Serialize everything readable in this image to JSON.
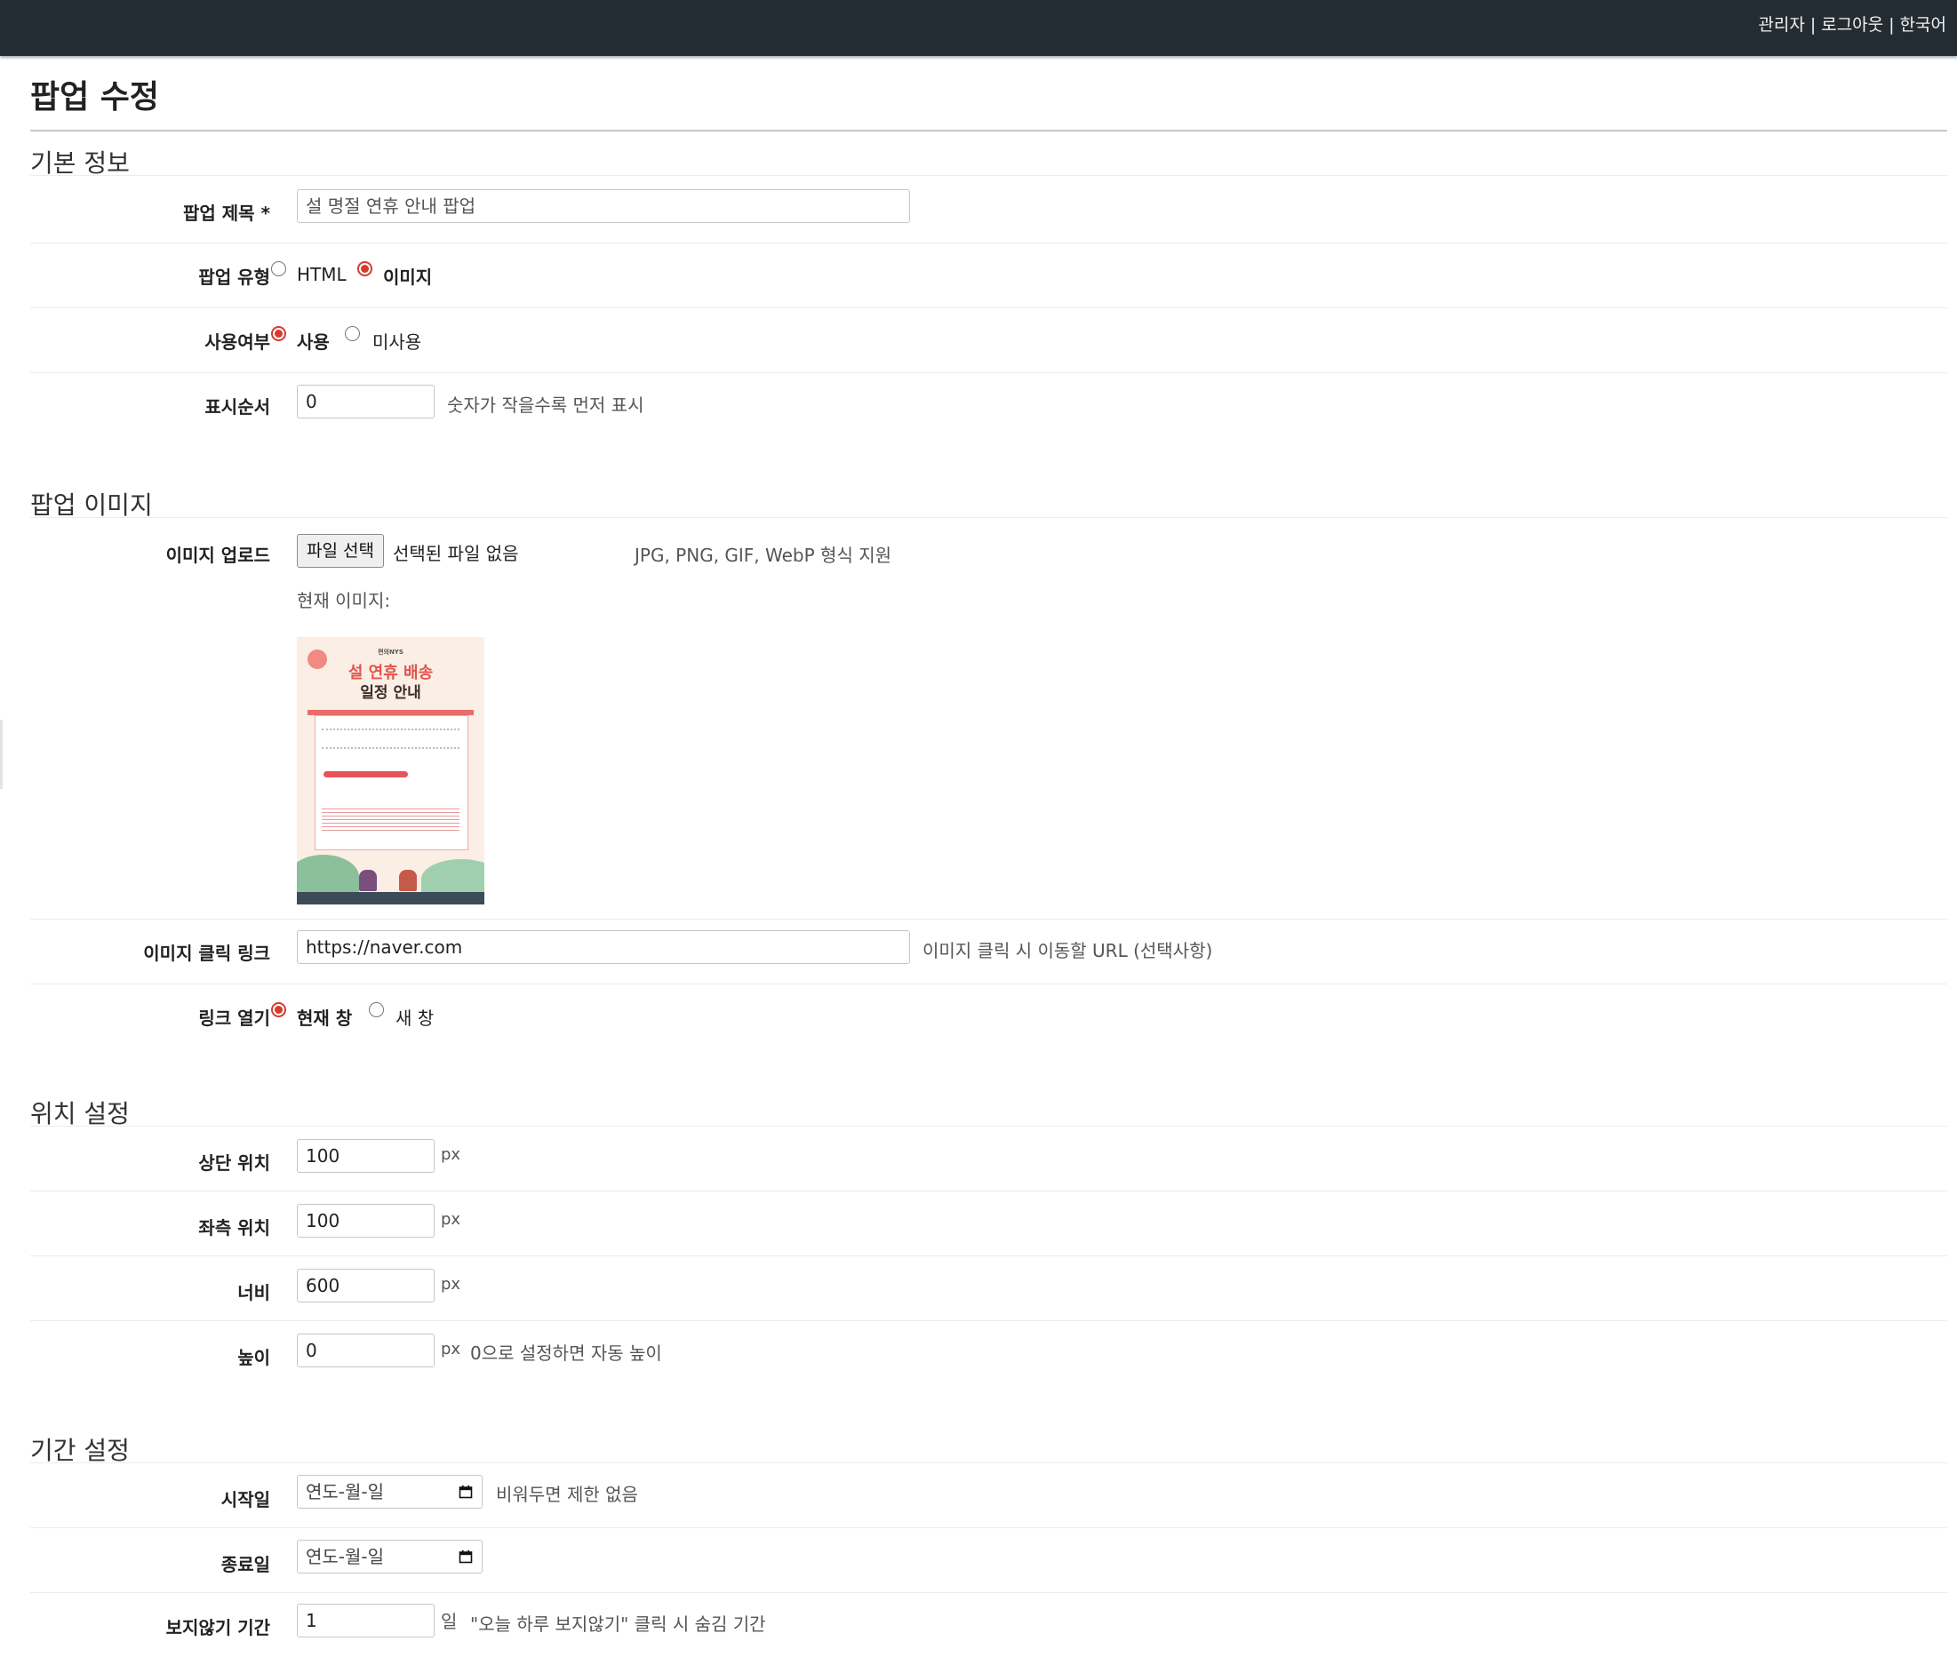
{
  "topnav": {
    "admin": "관리자",
    "logout": "로그아웃",
    "language": "한국어",
    "separator": "|"
  },
  "page_title": "팝업 수정",
  "sections": {
    "basic": "기본 정보",
    "image": "팝업 이미지",
    "position": "위치 설정",
    "period": "기간 설정"
  },
  "basic": {
    "title_label": "팝업 제목 *",
    "title_value": "설 명절 연휴 안내 팝업",
    "type_label": "팝업 유형",
    "type_options": {
      "html": "HTML",
      "image": "이미지"
    },
    "type_selected": "이미지",
    "use_label": "사용여부",
    "use_options": {
      "use": "사용",
      "unused": "미사용"
    },
    "use_selected": "사용",
    "order_label": "표시순서",
    "order_value": "0",
    "order_hint": "숫자가 작을수록 먼저 표시"
  },
  "image": {
    "upload_label": "이미지 업로드",
    "file_button": "파일 선택",
    "file_status": "선택된 파일 없음",
    "format_hint": "JPG, PNG, GIF, WebP 형식 지원",
    "current_label": "현재 이미지:",
    "preview": {
      "brand": "편의NYS",
      "line1": "설 연휴 배송",
      "line2": "일정 안내"
    },
    "link_label": "이미지 클릭 링크",
    "link_value": "https://naver.com",
    "link_hint": "이미지 클릭 시 이동할 URL (선택사항)",
    "open_label": "링크 열기",
    "open_options": {
      "current": "현재 창",
      "new": "새 창"
    },
    "open_selected": "현재 창"
  },
  "position": {
    "top_label": "상단 위치",
    "top_value": "100",
    "left_label": "좌측 위치",
    "left_value": "100",
    "width_label": "너비",
    "width_value": "600",
    "height_label": "높이",
    "height_value": "0",
    "unit": "px",
    "height_hint": "0으로 설정하면 자동 높이"
  },
  "period": {
    "start_label": "시작일",
    "start_placeholder": "연도-월-일",
    "start_hint": "비워두면 제한 없음",
    "end_label": "종료일",
    "end_placeholder": "연도-월-일",
    "hide_label": "보지않기 기간",
    "hide_value": "1",
    "hide_unit": "일",
    "hide_hint": "\"오늘 하루 보지않기\" 클릭 시 숨김 기간"
  },
  "colors": {
    "topbar": "#242c33",
    "radio_checked": "#d63b2f"
  }
}
